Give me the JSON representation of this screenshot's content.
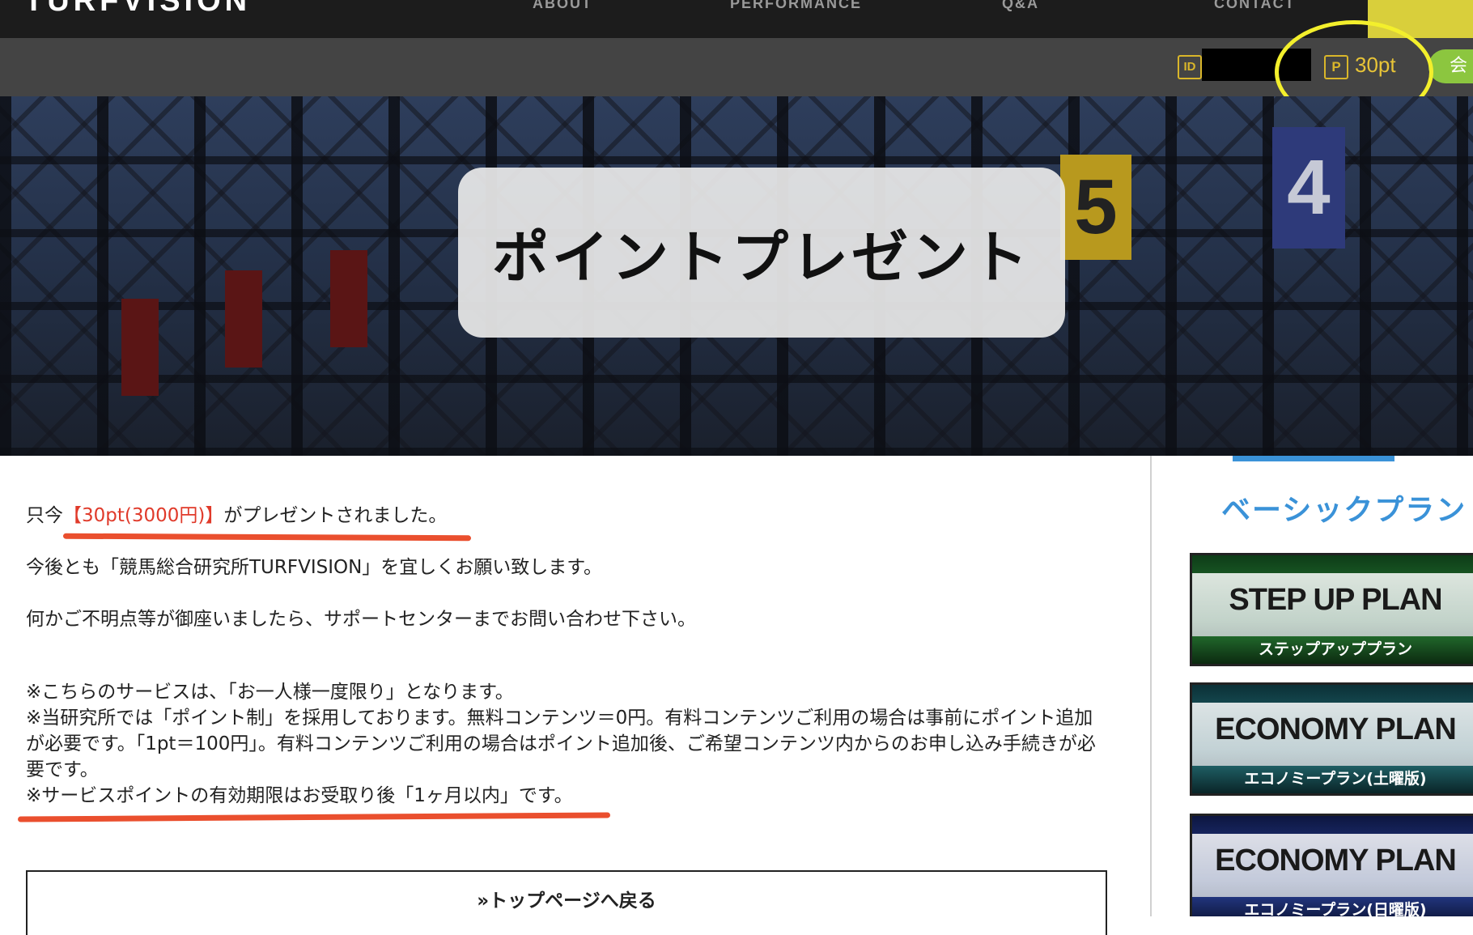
{
  "nav": {
    "logo": "TURFVISION",
    "items": [
      "ABOUT",
      "PERFORMANCE",
      "Q&A",
      "CONTACT"
    ]
  },
  "userbar": {
    "id_badge": "ID",
    "points_badge": "P",
    "points": "30pt",
    "member_button": "会"
  },
  "hero": {
    "title": "ポイントプレゼント",
    "gate_numbers": [
      "5",
      "4"
    ]
  },
  "main": {
    "line1_before": "只今",
    "line1_highlight": "【30pt(3000円)】",
    "line1_after": "がプレゼントされました。",
    "line2": "今後とも「競馬総合研究所TURFVISION」を宜しくお願い致します。",
    "line3": "何かご不明点等が御座いましたら、サポートセンターまでお問い合わせ下さい。",
    "notes": [
      "※こちらのサービスは、「お一人様一度限り」となります。",
      "※当研究所では「ポイント制」を採用しております。無料コンテンツ＝0円。有料コンテンツご利用の場合は事前にポイント追加が必要です。「1pt＝100円」。有料コンテンツご利用の場合はポイント追加後、ご希望コンテンツ内からのお申し込み手続きが必要です。",
      "※サービスポイントの有効期限はお受取り後「1ヶ月以内」です。"
    ],
    "back_button": "»トップページへ戻る"
  },
  "sidebar": {
    "heading": "ベーシックプラン",
    "plans": [
      {
        "name": "STEP UP PLAN",
        "sub": "ステップアッププラン"
      },
      {
        "name": "ECONOMY PLAN",
        "sub": "エコノミープラン(土曜版)"
      },
      {
        "name": "ECONOMY PLAN",
        "sub": "エコノミープラン(日曜版)"
      }
    ]
  },
  "colors": {
    "highlight": "#e03a2a",
    "points": "#e8c437",
    "accent_blue": "#3a92d8",
    "member_green": "#8cc63f"
  }
}
